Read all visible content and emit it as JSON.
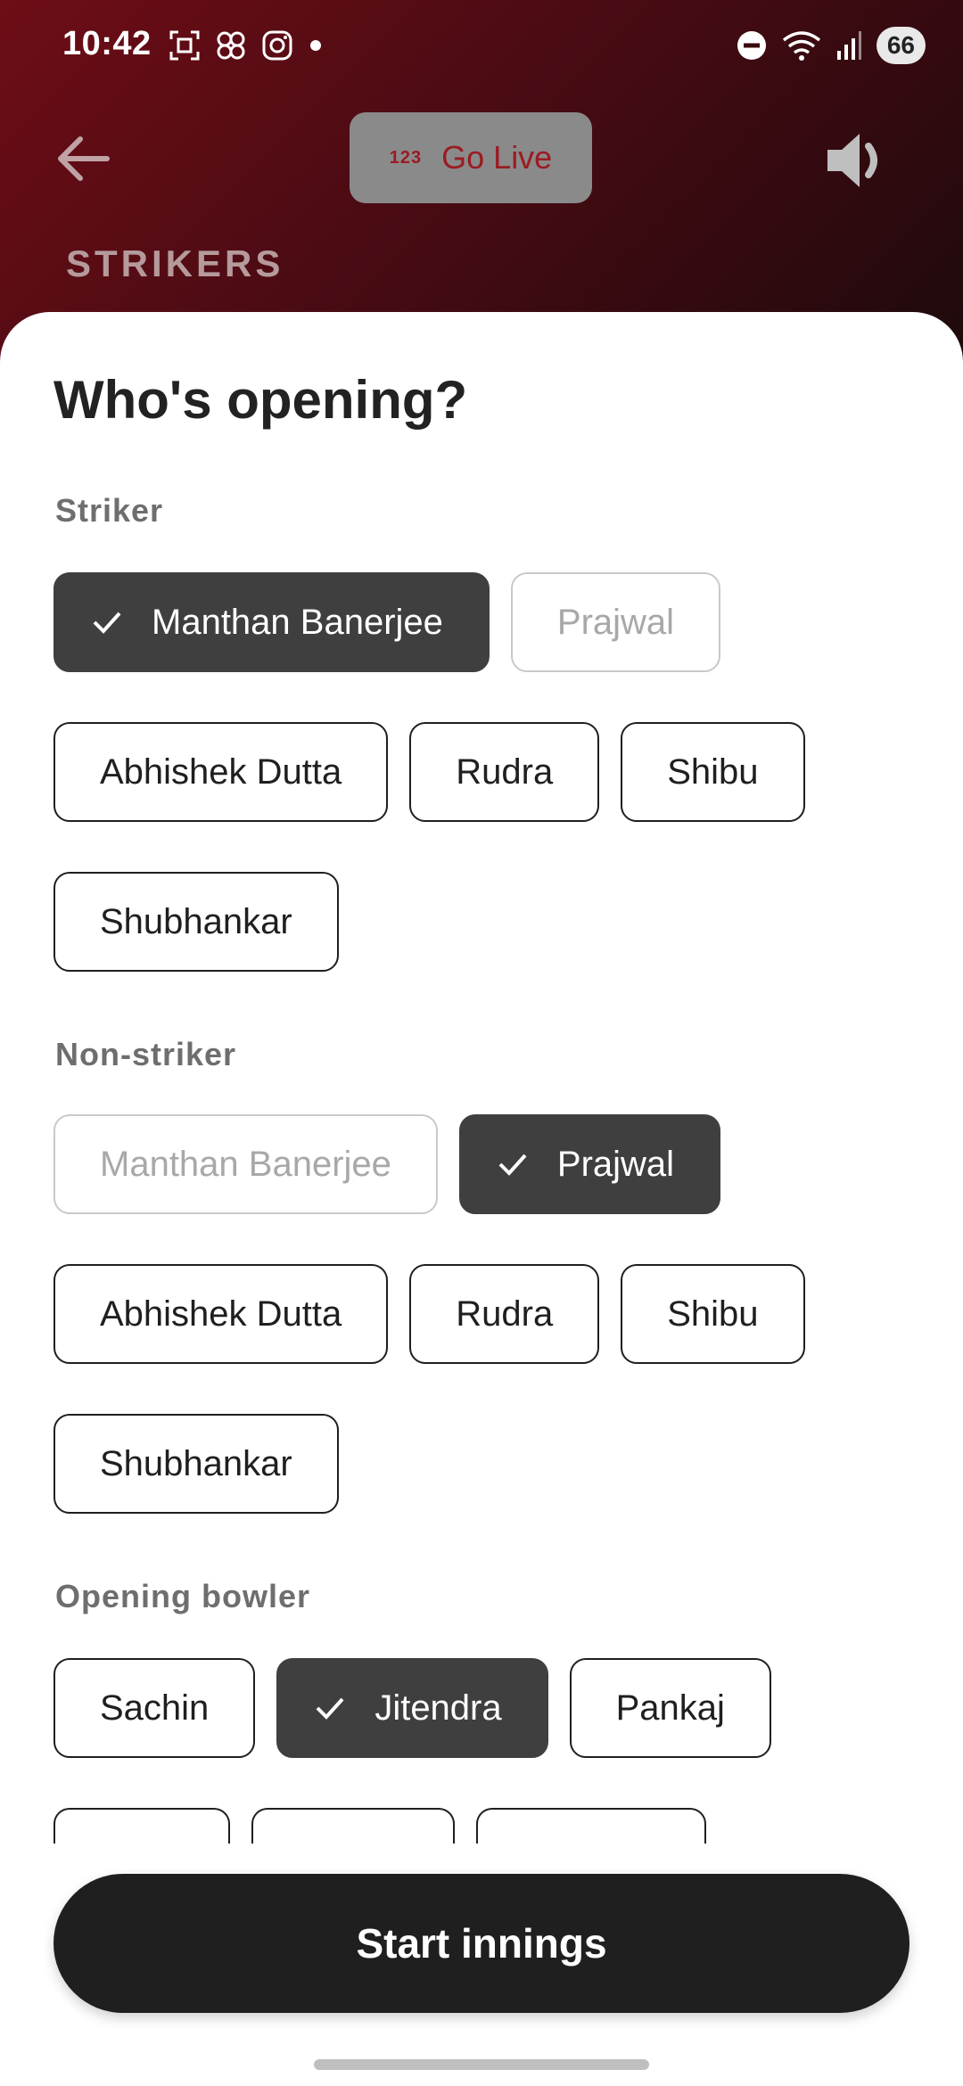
{
  "status_bar": {
    "time": "10:42",
    "battery": "66",
    "left_icons": [
      "screenshot-icon",
      "pinwheel-icon",
      "instagram-icon",
      "dot-icon"
    ],
    "right_icons": [
      "dnd-icon",
      "wifi-icon",
      "signal-icon"
    ]
  },
  "app_bar": {
    "go_live_prefix": "123",
    "go_live_label": "Go Live",
    "strikers_label": "STRIKERS",
    "accent_color": "#6e0d16"
  },
  "sheet": {
    "title": "Who's opening?",
    "striker": {
      "label": "Striker",
      "chips": [
        {
          "label": "Manthan Banerjee",
          "state": "selected"
        },
        {
          "label": "Prajwal",
          "state": "disabled"
        },
        {
          "label": "Abhishek Dutta",
          "state": "default"
        },
        {
          "label": "Rudra",
          "state": "default"
        },
        {
          "label": "Shibu",
          "state": "default"
        },
        {
          "label": "Shubhankar",
          "state": "default"
        }
      ]
    },
    "non_striker": {
      "label": "Non-striker",
      "chips": [
        {
          "label": "Manthan Banerjee",
          "state": "disabled"
        },
        {
          "label": "Prajwal",
          "state": "selected"
        },
        {
          "label": "Abhishek Dutta",
          "state": "default"
        },
        {
          "label": "Rudra",
          "state": "default"
        },
        {
          "label": "Shibu",
          "state": "default"
        },
        {
          "label": "Shubhankar",
          "state": "default"
        }
      ]
    },
    "opening_bowler": {
      "label": "Opening bowler",
      "chips": [
        {
          "label": "Sachin",
          "state": "default"
        },
        {
          "label": "Jitendra",
          "state": "selected"
        },
        {
          "label": "Pankaj",
          "state": "default"
        }
      ]
    },
    "start_button": "Start innings"
  }
}
